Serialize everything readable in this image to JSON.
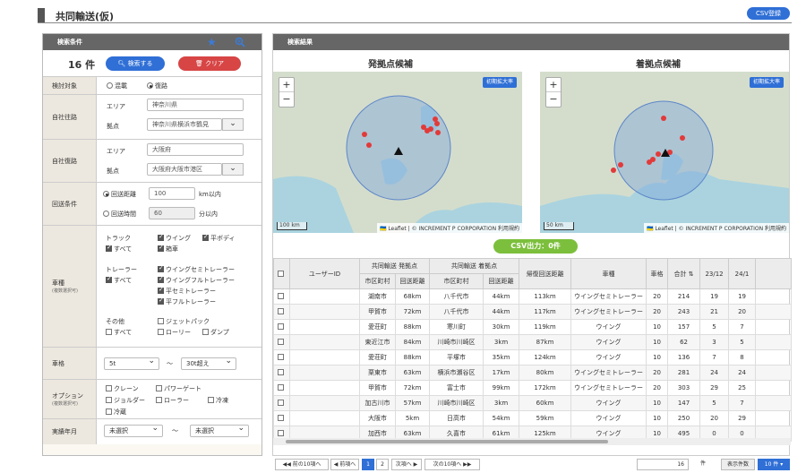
{
  "title": "共同輸送(仮)",
  "csv_register": "CSV登録",
  "left": {
    "header": "検索条件",
    "count": "16 件",
    "search_btn": "検索する",
    "clear_btn": "クリア",
    "f1": {
      "label": "検討対象",
      "opt1": "混載",
      "opt2": "復路"
    },
    "f2": {
      "label": "自社往路",
      "area_lbl": "エリア",
      "area": "神奈川県",
      "base_lbl": "拠点",
      "base": "神奈川県横浜市鶴見"
    },
    "f3": {
      "label": "自社復路",
      "area_lbl": "エリア",
      "area": "大阪府",
      "base_lbl": "拠点",
      "base": "大阪府大阪市港区"
    },
    "f4": {
      "label": "回送条件",
      "opt1": "回送距離",
      "dist": "100",
      "dist_unit": "km以内",
      "opt2": "回送時間",
      "time": "60",
      "time_unit": "分以内"
    },
    "f5": {
      "label": "車種",
      "sub": "(複数選択可)",
      "truck": "トラック",
      "all": "すべて",
      "wing": "ウイング",
      "flat": "平ボディ",
      "box": "箱車",
      "trailer": "トレーラー",
      "ws": "ウイングセミトレーラー",
      "wf": "ウイングフルトレーラー",
      "fs": "平セミトレーラー",
      "ff": "平フルトレーラー",
      "other": "その他",
      "jet": "ジェットパック",
      "lorry": "ローリー",
      "dump": "ダンプ"
    },
    "f6": {
      "label": "車格",
      "from": "5t",
      "sep": "〜",
      "to": "30t超え"
    },
    "f7": {
      "label": "オプション",
      "sub": "(複数選択可)",
      "crane": "クレーン",
      "pg": "パワーゲート",
      "jolder": "ジョルダー",
      "roller": "ローラー",
      "cold": "冷凍",
      "chill": "冷蔵"
    },
    "f8": {
      "label": "実績年月",
      "from": "未選択",
      "sep": "〜",
      "to": "未選択"
    }
  },
  "right": {
    "header": "検索結果",
    "map1_title": "発拠点候補",
    "map2_title": "着拠点候補",
    "reset_btn": "初期拡大率",
    "zoom_in": "+",
    "zoom_out": "−",
    "attribution": "🇺🇦 Leaflet | © INCREMENT P CORPORATION 利用規約",
    "scale1": "100 km",
    "scale2": "50 km",
    "csv_btn": "CSV出力：0件",
    "cols": {
      "user": "ユーザーID",
      "dep": "共同輸送 発拠点",
      "arr": "共同輸送 着拠点",
      "city": "市区町村",
      "dist": "回送距離",
      "ret": "帰復回送距離",
      "kind": "車種",
      "grade": "車格",
      "total": "合計",
      "m1": "23/12",
      "m2": "24/1"
    },
    "rows": [
      [
        "湖南市",
        "68km",
        "八千代市",
        "44km",
        "113km",
        "ウイングセミトレーラー",
        "20",
        "214",
        "19",
        "19"
      ],
      [
        "甲賀市",
        "72km",
        "八千代市",
        "44km",
        "117km",
        "ウイングセミトレーラー",
        "20",
        "243",
        "21",
        "20"
      ],
      [
        "愛荘町",
        "88km",
        "寒川町",
        "30km",
        "119km",
        "ウイング",
        "10",
        "157",
        "5",
        "7"
      ],
      [
        "東近江市",
        "84km",
        "川崎市川崎区",
        "3km",
        "87km",
        "ウイング",
        "10",
        "62",
        "3",
        "5"
      ],
      [
        "愛荘町",
        "88km",
        "平塚市",
        "35km",
        "124km",
        "ウイング",
        "10",
        "136",
        "7",
        "8"
      ],
      [
        "栗東市",
        "63km",
        "横浜市瀬谷区",
        "17km",
        "80km",
        "ウイングセミトレーラー",
        "20",
        "281",
        "24",
        "24"
      ],
      [
        "甲賀市",
        "72km",
        "富士市",
        "99km",
        "172km",
        "ウイングセミトレーラー",
        "20",
        "303",
        "29",
        "25"
      ],
      [
        "加古川市",
        "57km",
        "川崎市川崎区",
        "3km",
        "60km",
        "ウイング",
        "10",
        "147",
        "5",
        "7"
      ],
      [
        "大阪市",
        "5km",
        "日高市",
        "54km",
        "59km",
        "ウイング",
        "10",
        "250",
        "20",
        "29"
      ],
      [
        "加西市",
        "63km",
        "久喜市",
        "61km",
        "125km",
        "ウイング",
        "10",
        "495",
        "0",
        "0"
      ]
    ],
    "pager": {
      "first": "前の10項へ",
      "prev": "前項へ",
      "p1": "1",
      "p2": "2",
      "next": "次項へ",
      "last": "次の10項へ",
      "total": "16",
      "unit": "件",
      "per_lbl": "表示件数",
      "per": "10 件"
    }
  }
}
